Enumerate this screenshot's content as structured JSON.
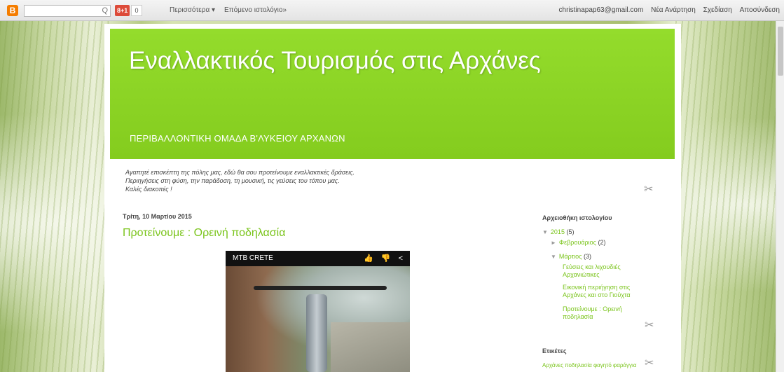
{
  "navbar": {
    "logo": "B",
    "search_icon": "Q",
    "gplus": "8+1",
    "gcount": "0",
    "more": "Περισσότερα ▾",
    "next_blog": "Επόμενο ιστολόγιο»",
    "user_email": "christinapap63@gmail.com",
    "new_post": "Νέα Ανάρτηση",
    "design": "Σχεδίαση",
    "sign_out": "Αποσύνδεση"
  },
  "header": {
    "title": "Εναλλακτικός Τουρισμός στις Αρχάνες",
    "description": "ΠΕΡΙΒΑΛΛΟΝΤΙΚΗ ΟΜΑΔΑ Β'ΛΥΚΕΙΟΥ ΑΡΧΑΝΩΝ"
  },
  "intro": {
    "line1": "Αγαπητέ επισκέπτη της πόλης μας, εδώ θα σου προτείνουμε εναλλακτικές δράσεις.",
    "line2": "Περιηγήσεις στη φύση, την παράδοση, τη μουσική, τις γεύσεις του τόπου μας.",
    "line3": "Καλές διακοπές !"
  },
  "post": {
    "date": "Τρίτη, 10 Μαρτίου 2015",
    "title": "Προτείνουμε : Ορεινή ποδηλασία",
    "video_title": "MTB CRETE",
    "video_actions": "👍 👎 <"
  },
  "sidebar": {
    "archive_heading": "Αρχειοθήκη ιστολογίου",
    "year": "2015",
    "year_count": "(5)",
    "feb": "Φεβρουάριος",
    "feb_count": "(2)",
    "mar": "Μάρτιος",
    "mar_count": "(3)",
    "posts": [
      "Γεύσεις και λιχουδιές Αρχανιώτικες",
      "Εικονική περιήγηση στις Αρχάνες και στο Γιούχτα",
      "Προτείνουμε : Ορεινή ποδηλασία"
    ],
    "labels_heading": "Ετικέτες",
    "labels_text": "Αρχάνες ποδηλασία φαγητό φαράγγια"
  },
  "icons": {
    "tools": "✂"
  }
}
